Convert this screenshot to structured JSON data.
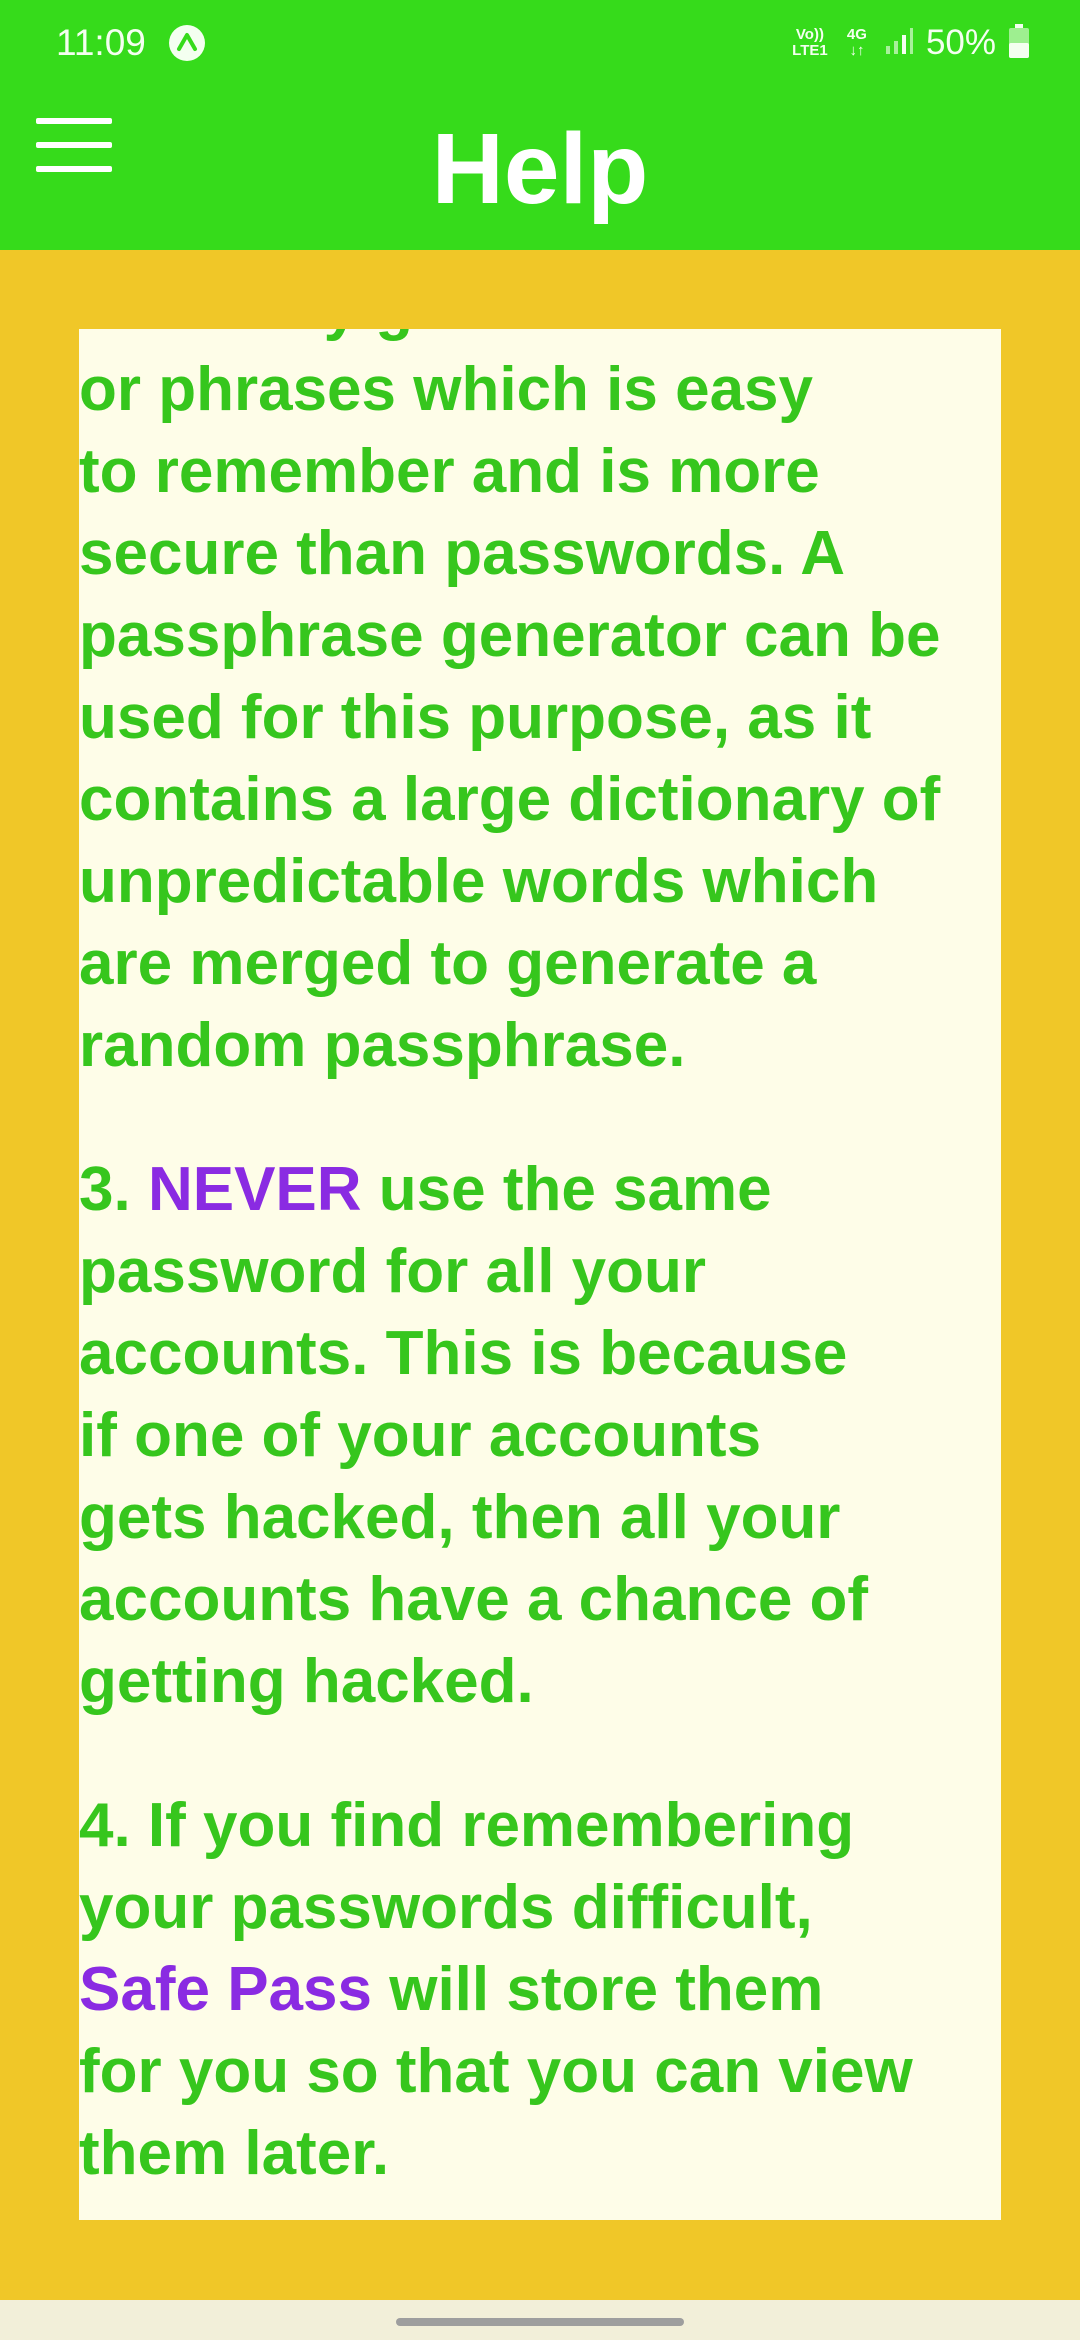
{
  "status_bar": {
    "time": "11:09",
    "volte_top": "Vo))",
    "volte_bottom": "LTE1",
    "network": "4G",
    "battery": "50%"
  },
  "app_bar": {
    "title": "Help",
    "menu_icon": "hamburger-menu-icon"
  },
  "help": {
    "p2_lines": [
      "randomly generated words",
      "or phrases which is easy",
      "to remember and is more",
      "secure than passwords. A",
      "passphrase generator can be",
      "used for this purpose, as it",
      "contains a large dictionary of",
      "unpredictable words which",
      "are merged to generate a",
      "random passphrase."
    ],
    "p3": {
      "prefix": "3. ",
      "emphasis": "NEVER",
      "line1_rest": " use the same",
      "lines": [
        "password for all your",
        "accounts. This is because",
        "if one of your accounts",
        "gets hacked, then all your",
        "accounts have a chance of",
        "getting hacked."
      ]
    },
    "p4": {
      "lines_before": [
        "4. If you find remembering",
        "your passwords difficult,"
      ],
      "app_name": "Safe Pass",
      "after_app_name": " will store them",
      "lines_after": [
        "for you so that you can view",
        "them later."
      ]
    }
  },
  "colors": {
    "app_bar": "#36DB1B",
    "page_background": "#F0C728",
    "card_background": "#FEFDE8",
    "text": "#36C61D",
    "accent": "#8A2BE2"
  }
}
